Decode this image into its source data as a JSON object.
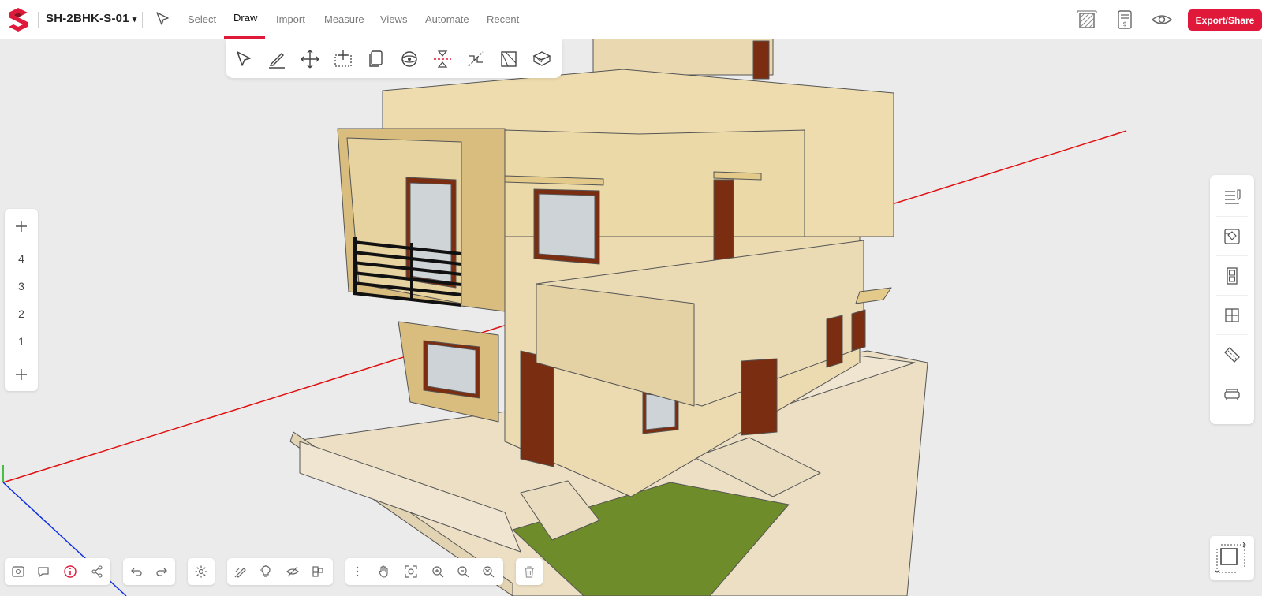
{
  "project": {
    "name": "SH-2BHK-S-01"
  },
  "menu": {
    "items": [
      "Select",
      "Draw",
      "Import",
      "Measure",
      "Views",
      "Automate",
      "Recent"
    ],
    "active": "Draw"
  },
  "actions": {
    "export_label": "Export/Share"
  },
  "draw_tools": [
    "select-arrow",
    "pencil",
    "move",
    "add-to-selection",
    "copy",
    "orbit",
    "section-plane",
    "split",
    "face",
    "extrude"
  ],
  "floors": {
    "levels": [
      "4",
      "3",
      "2",
      "1"
    ]
  },
  "right_panel": {
    "icons": [
      "properties-icon",
      "paint-bucket-icon",
      "door-icon",
      "window-icon",
      "ruler-icon",
      "furniture-icon"
    ]
  },
  "colors": {
    "accent": "#e0183a",
    "x_axis": "#e01010",
    "y_axis": "#1030e0",
    "z_axis": "#10b010"
  }
}
